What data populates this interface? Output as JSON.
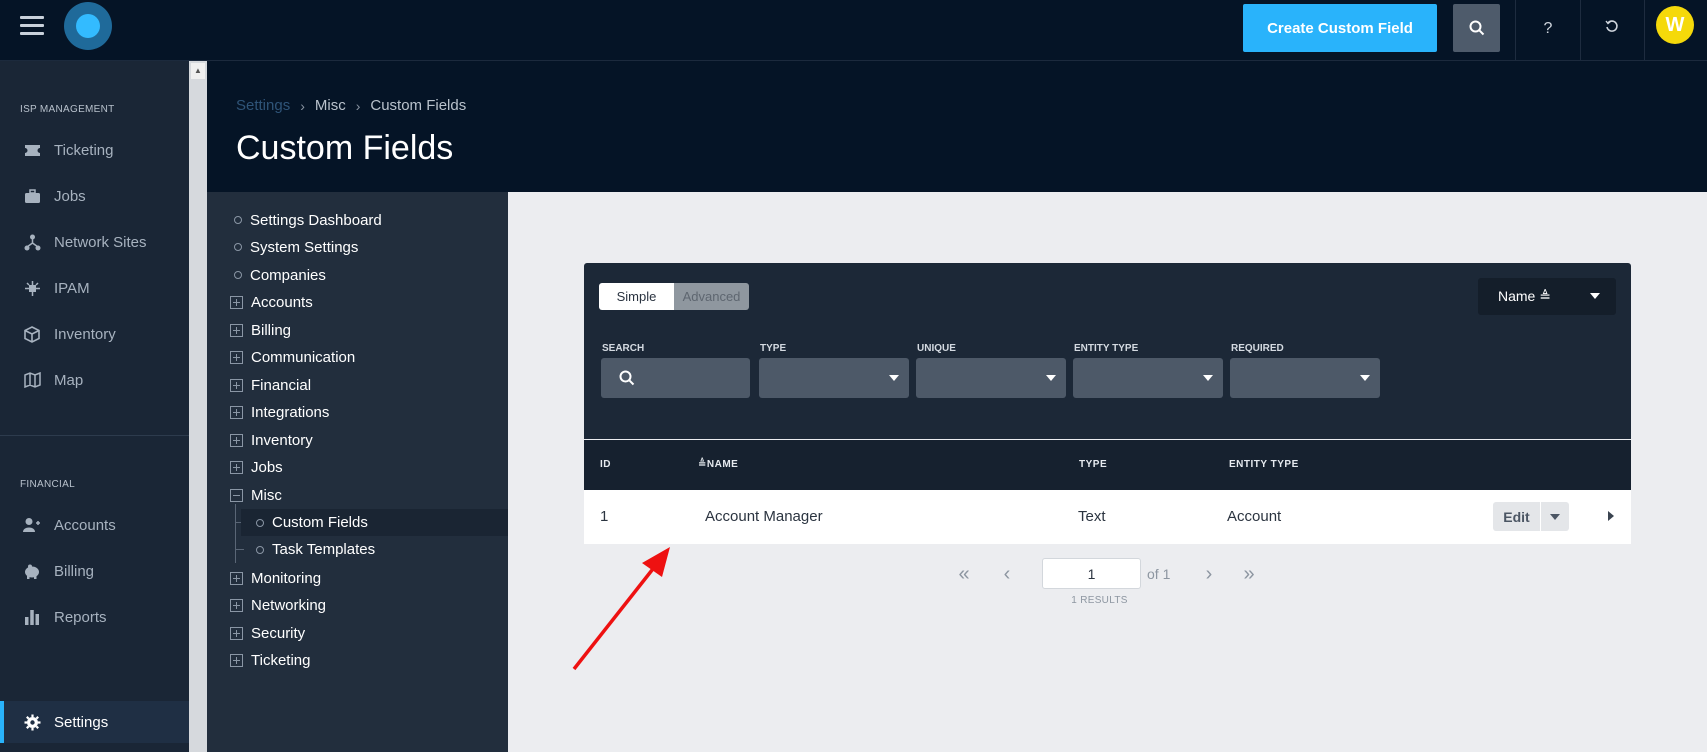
{
  "topbar": {
    "create_button_label": "Create Custom Field",
    "help_icon": "?",
    "user_initial": "W",
    "accent": "#29b3fb",
    "avatar_color": "#f5d90a"
  },
  "leftnav": {
    "section_isp": "ISP MANAGEMENT",
    "section_financial": "FINANCIAL",
    "isp_items": [
      {
        "label": "Ticketing",
        "icon": "ticket-icon"
      },
      {
        "label": "Jobs",
        "icon": "briefcase-icon"
      },
      {
        "label": "Network Sites",
        "icon": "network-icon"
      },
      {
        "label": "IPAM",
        "icon": "ipam-icon"
      },
      {
        "label": "Inventory",
        "icon": "box-icon"
      },
      {
        "label": "Map",
        "icon": "map-icon"
      }
    ],
    "financial_items": [
      {
        "label": "Accounts",
        "icon": "accounts-icon"
      },
      {
        "label": "Billing",
        "icon": "piggy-bank-icon"
      },
      {
        "label": "Reports",
        "icon": "bar-chart-icon"
      }
    ],
    "settings_label": "Settings"
  },
  "header": {
    "breadcrumb": [
      "Settings",
      "Misc",
      "Custom Fields"
    ],
    "title": "Custom Fields"
  },
  "tree": {
    "items": [
      {
        "label": "Settings Dashboard",
        "kind": "leaf"
      },
      {
        "label": "System Settings",
        "kind": "leaf"
      },
      {
        "label": "Companies",
        "kind": "leaf"
      },
      {
        "label": "Accounts",
        "kind": "collapsed"
      },
      {
        "label": "Billing",
        "kind": "collapsed"
      },
      {
        "label": "Communication",
        "kind": "collapsed"
      },
      {
        "label": "Financial",
        "kind": "collapsed"
      },
      {
        "label": "Integrations",
        "kind": "collapsed"
      },
      {
        "label": "Inventory",
        "kind": "collapsed"
      },
      {
        "label": "Jobs",
        "kind": "collapsed"
      },
      {
        "label": "Misc",
        "kind": "expanded"
      },
      {
        "label": "Monitoring",
        "kind": "collapsed"
      },
      {
        "label": "Networking",
        "kind": "collapsed"
      },
      {
        "label": "Security",
        "kind": "collapsed"
      },
      {
        "label": "Ticketing",
        "kind": "collapsed"
      }
    ],
    "misc_children": [
      {
        "label": "Custom Fields",
        "selected": true
      },
      {
        "label": "Task Templates",
        "selected": false
      }
    ]
  },
  "filters": {
    "mode_simple": "Simple",
    "mode_advanced": "Advanced",
    "active_mode": "Simple",
    "sort_label": "Name ≜",
    "search_label": "SEARCH",
    "type_label": "TYPE",
    "unique_label": "UNIQUE",
    "entity_type_label": "ENTITY TYPE",
    "required_label": "REQUIRED"
  },
  "table": {
    "columns": [
      "ID",
      "≜NAME",
      "TYPE",
      "ENTITY TYPE"
    ],
    "rows": [
      {
        "id": "1",
        "name": "Account Manager",
        "type": "Text",
        "entity_type": "Account"
      }
    ],
    "edit_label": "Edit"
  },
  "pagination": {
    "page": "1",
    "of_label": "of 1",
    "results_label": "1 RESULTS"
  },
  "annotation": {
    "arrow_color": "#ee1111"
  }
}
